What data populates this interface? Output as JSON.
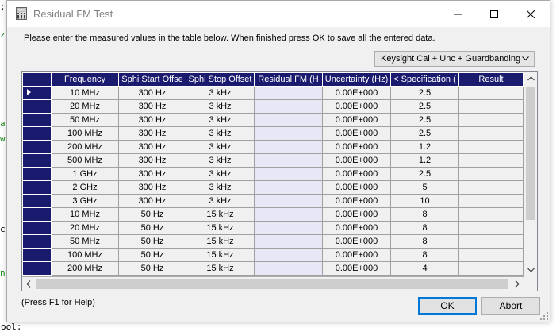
{
  "window": {
    "title": "Residual FM Test",
    "instructions": "Please enter the measured values in the table below. When finished press OK to save all the entered data."
  },
  "mode_select": {
    "value": "Keysight Cal + Unc + Guardbanding"
  },
  "table": {
    "columns": [
      "Frequency",
      "Sphi Start Offse",
      "Sphi Stop Offset",
      "Residual FM (H",
      "Uncertainty (Hz)",
      "< Specification (",
      "Result"
    ],
    "rows": [
      [
        "10 MHz",
        "300 Hz",
        "3 kHz",
        "",
        "0.00E+000",
        "2.5",
        ""
      ],
      [
        "20 MHz",
        "300 Hz",
        "3 kHz",
        "",
        "0.00E+000",
        "2.5",
        ""
      ],
      [
        "50 MHz",
        "300 Hz",
        "3 kHz",
        "",
        "0.00E+000",
        "2.5",
        ""
      ],
      [
        "100 MHz",
        "300 Hz",
        "3 kHz",
        "",
        "0.00E+000",
        "2.5",
        ""
      ],
      [
        "200 MHz",
        "300 Hz",
        "3 kHz",
        "",
        "0.00E+000",
        "1.2",
        ""
      ],
      [
        "500 MHz",
        "300 Hz",
        "3 kHz",
        "",
        "0.00E+000",
        "1.2",
        ""
      ],
      [
        "1 GHz",
        "300 Hz",
        "3 kHz",
        "",
        "0.00E+000",
        "2.5",
        ""
      ],
      [
        "2 GHz",
        "300 Hz",
        "3 kHz",
        "",
        "0.00E+000",
        "5",
        ""
      ],
      [
        "3 GHz",
        "300 Hz",
        "3 kHz",
        "",
        "0.00E+000",
        "10",
        ""
      ],
      [
        "10 MHz",
        "50 Hz",
        "15 kHz",
        "",
        "0.00E+000",
        "8",
        ""
      ],
      [
        "20 MHz",
        "50 Hz",
        "15 kHz",
        "",
        "0.00E+000",
        "8",
        ""
      ],
      [
        "50 MHz",
        "50 Hz",
        "15 kHz",
        "",
        "0.00E+000",
        "8",
        ""
      ],
      [
        "100 MHz",
        "50 Hz",
        "15 kHz",
        "",
        "0.00E+000",
        "8",
        ""
      ],
      [
        "200 MHz",
        "50 Hz",
        "15 kHz",
        "",
        "0.00E+000",
        "4",
        ""
      ]
    ]
  },
  "footer": {
    "help_text": "(Press F1 for Help)",
    "ok_label": "OK",
    "abort_label": "Abort"
  },
  "background_fragments": [
    ";",
    "z",
    "a",
    "w",
    "c",
    "n",
    "ool:"
  ],
  "colors": {
    "header_bg": "#1a1a6e",
    "residual_fm_cell": "#e7e7f5",
    "focus_border": "#0078d7"
  }
}
